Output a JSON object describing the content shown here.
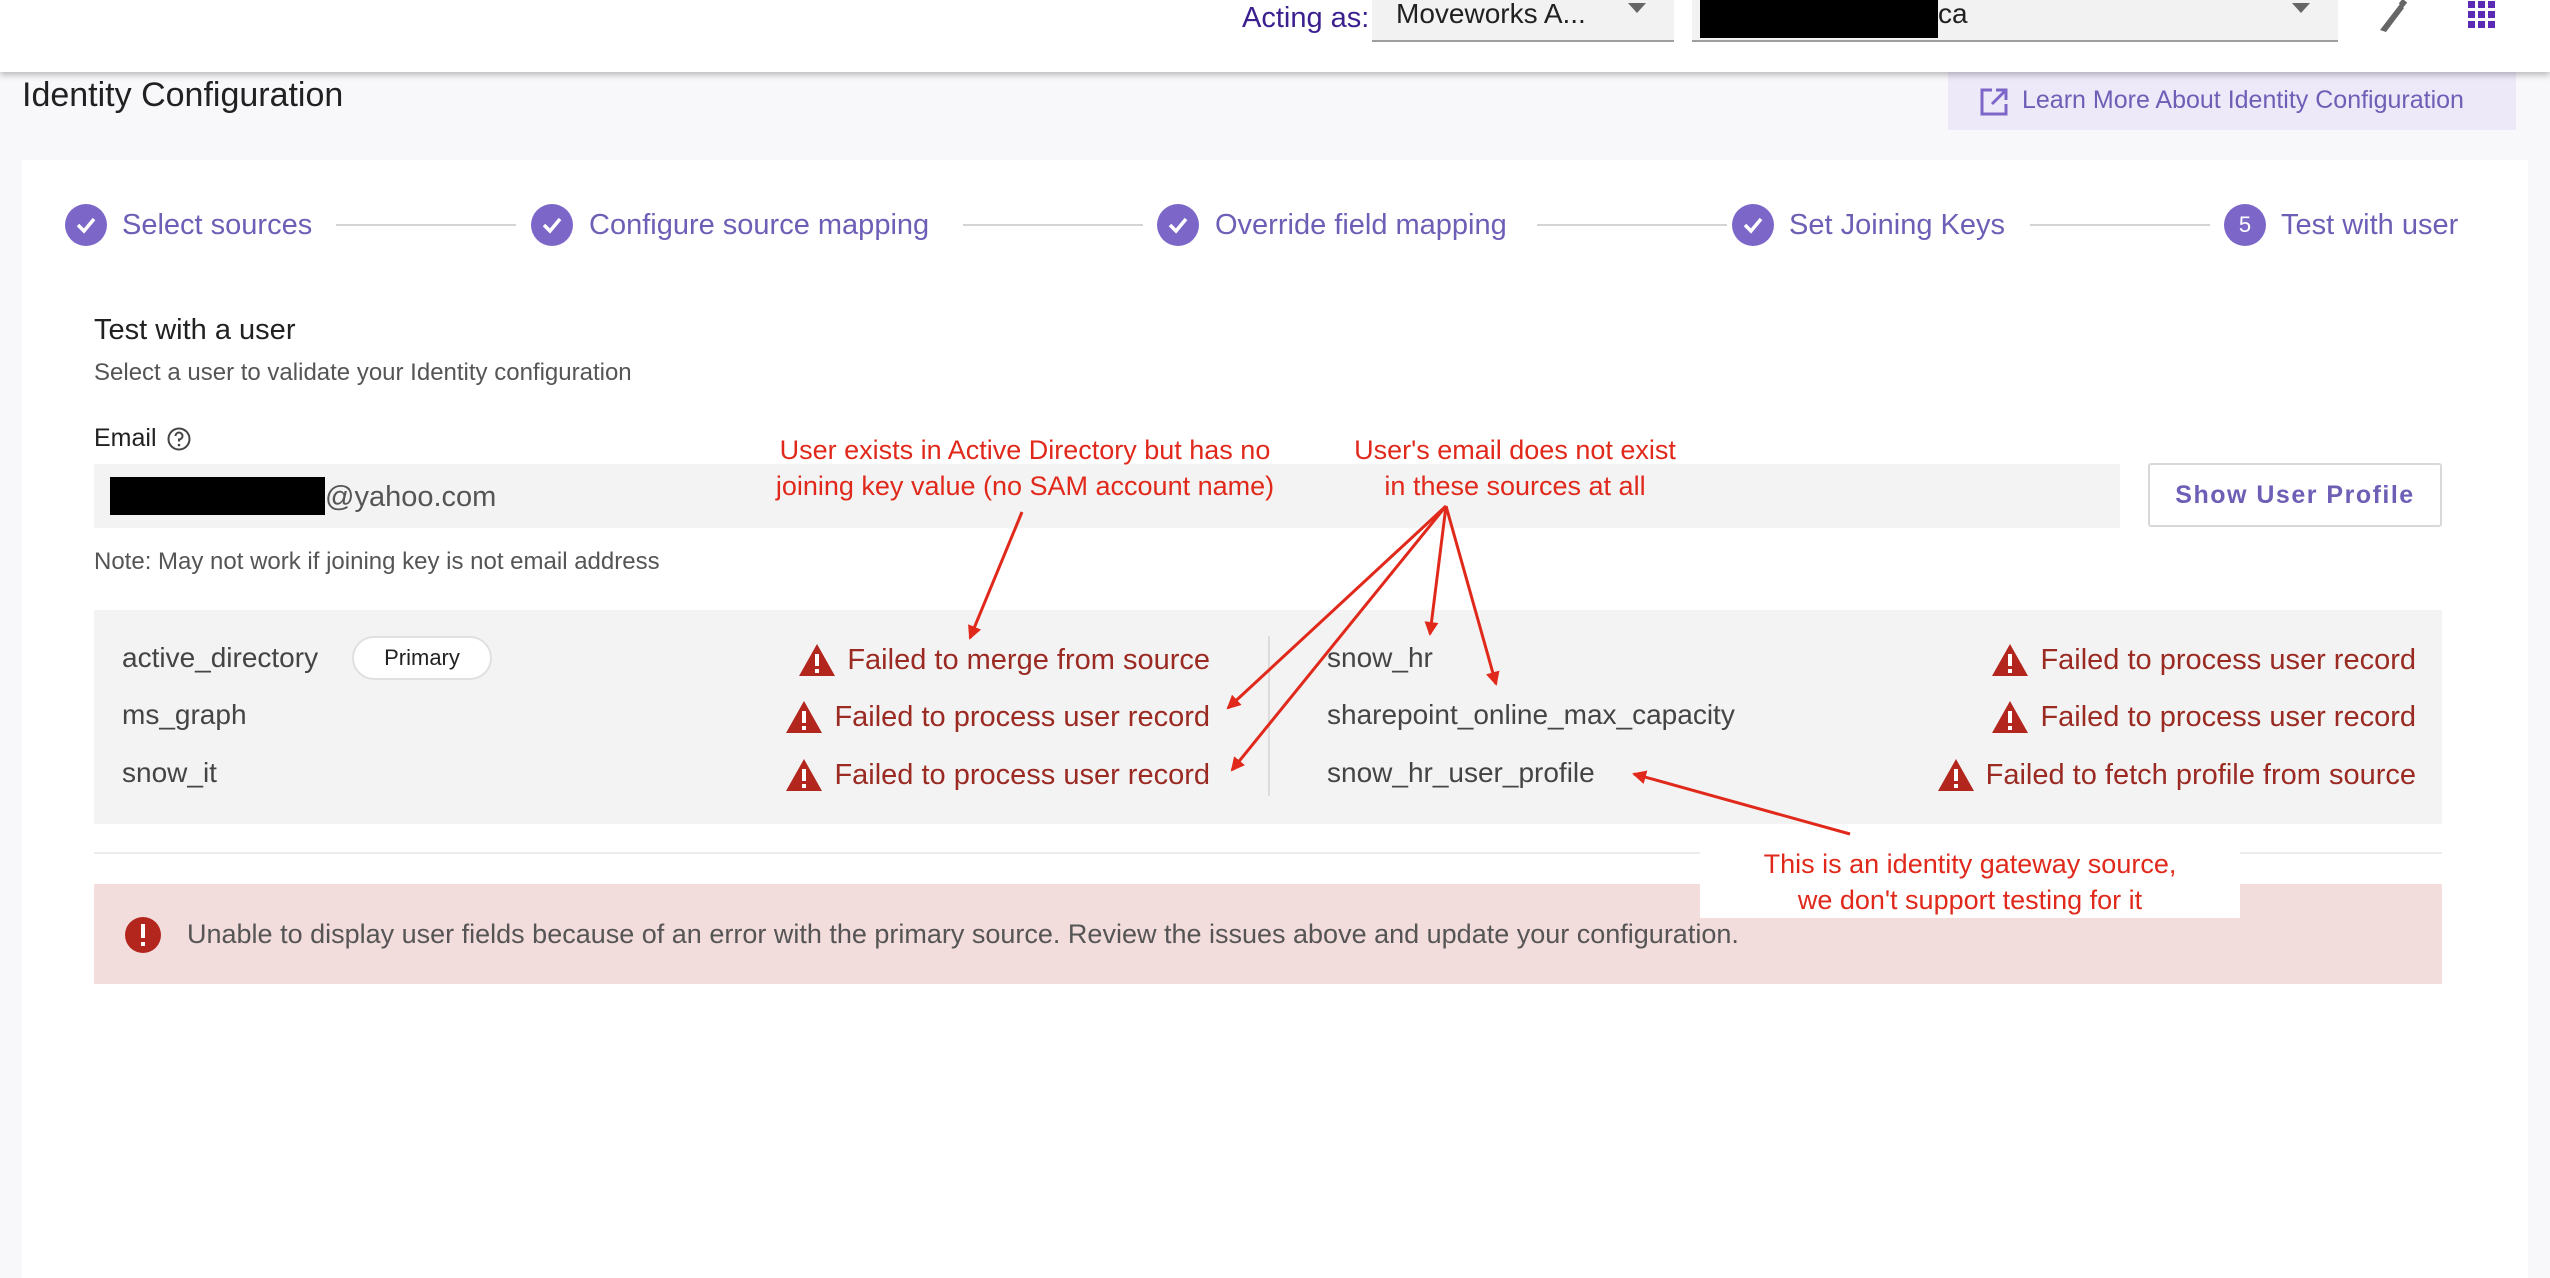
{
  "header": {
    "acting_as_label": "Acting as:",
    "org_select_value": "Moveworks A...",
    "env_select_suffix": "ca"
  },
  "page": {
    "title": "Identity Configuration",
    "learn_more": "Learn More About Identity Configuration"
  },
  "stepper": {
    "steps": [
      {
        "label": "Select sources",
        "state": "done"
      },
      {
        "label": "Configure source mapping",
        "state": "done"
      },
      {
        "label": "Override field mapping",
        "state": "done"
      },
      {
        "label": "Set Joining Keys",
        "state": "done"
      },
      {
        "label": "Test with user",
        "state": "active",
        "number": "5"
      }
    ]
  },
  "test": {
    "title": "Test with a user",
    "subtitle": "Select a user to validate your Identity configuration",
    "email_label": "Email",
    "email_suffix": "@yahoo.com",
    "show_profile_button": "Show User Profile",
    "note": "Note: May not work if joining key is not email address"
  },
  "results": {
    "left": [
      {
        "source": "active_directory",
        "badge": "Primary",
        "status": "Failed to merge from source"
      },
      {
        "source": "ms_graph",
        "status": "Failed to process user record"
      },
      {
        "source": "snow_it",
        "status": "Failed to process user record"
      }
    ],
    "right": [
      {
        "source": "snow_hr",
        "status": "Failed to process user record"
      },
      {
        "source": "sharepoint_online_max_capacity",
        "status": "Failed to process user record"
      },
      {
        "source": "snow_hr_user_profile",
        "status": "Failed to fetch profile from source"
      }
    ]
  },
  "alert": {
    "message": "Unable to display user fields because of an error with the primary source. Review the issues above and update your configuration."
  },
  "annotations": {
    "a1_line1": "User exists in Active Directory but has no",
    "a1_line2": "joining key value (no SAM account name)",
    "a2_line1": "User's email does not exist",
    "a2_line2": "in these sources at all",
    "a3_line1": "This is an identity gateway source,",
    "a3_line2": "we don't support testing for it"
  },
  "colors": {
    "accent": "#7c67c9",
    "error": "#9a2a22",
    "annotation": "#e0291b",
    "alert_bg": "#f3dcdc"
  }
}
